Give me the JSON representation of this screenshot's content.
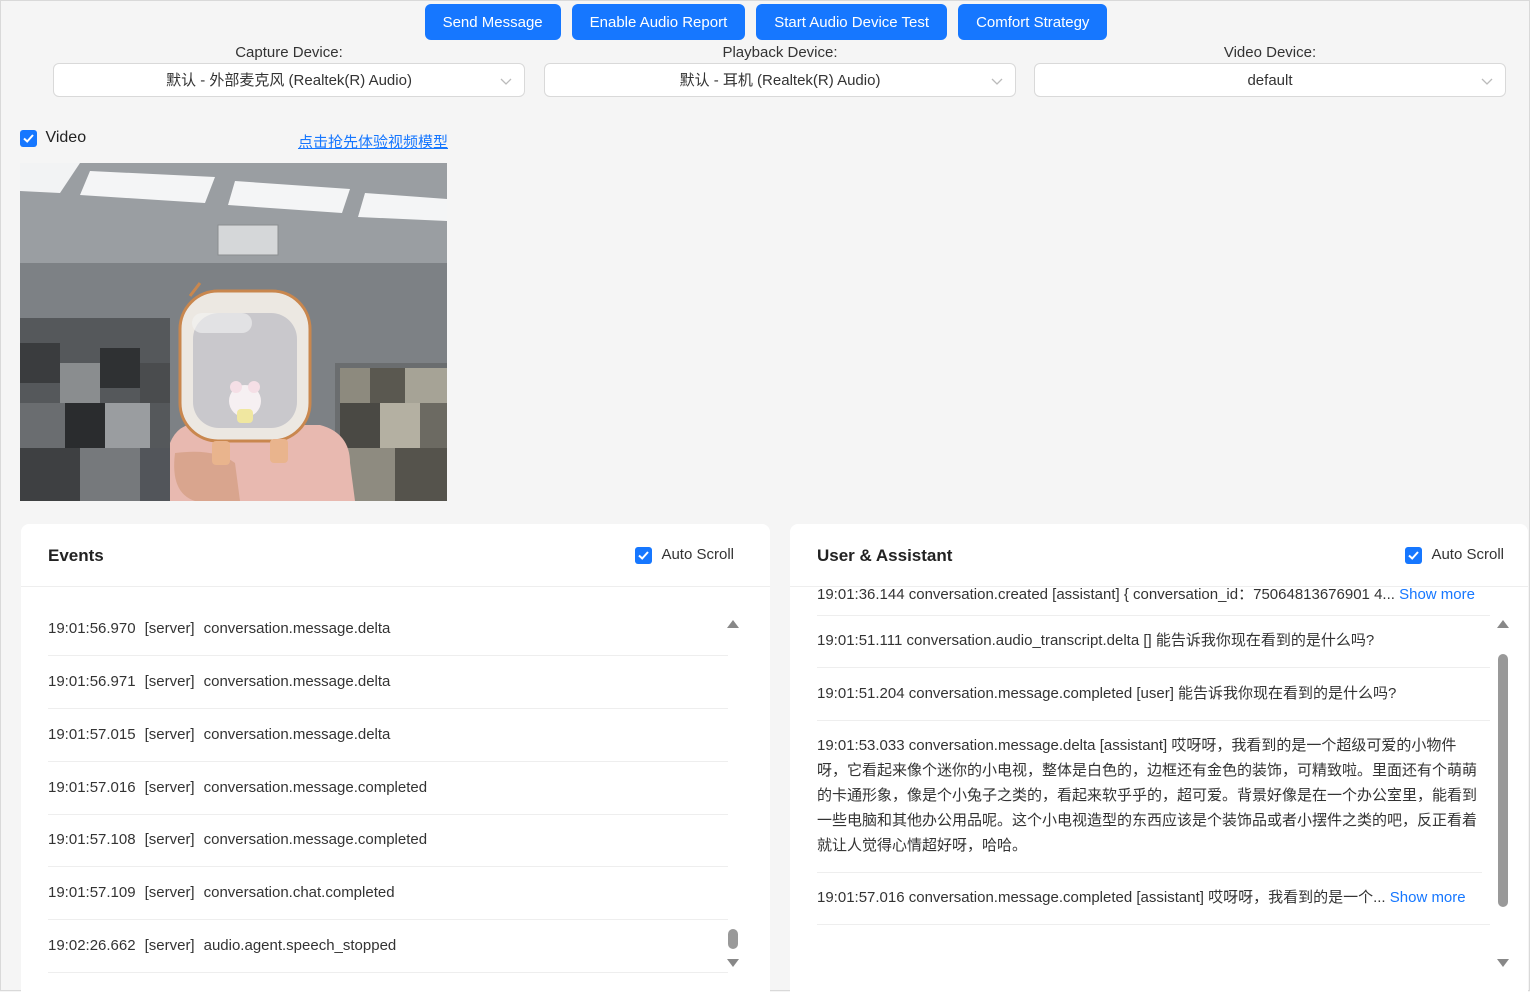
{
  "toolbar": {
    "send_message": "Send Message",
    "enable_audio_report": "Enable Audio Report",
    "start_audio_test": "Start Audio Device Test",
    "comfort_strategy": "Comfort Strategy"
  },
  "devices": {
    "capture": {
      "label": "Capture Device:",
      "value": "默认 - 外部麦克风 (Realtek(R) Audio)"
    },
    "playback": {
      "label": "Playback Device:",
      "value": "默认 - 耳机 (Realtek(R) Audio)"
    },
    "video": {
      "label": "Video Device:",
      "value": "default"
    }
  },
  "video": {
    "checkbox_label": "Video",
    "model_link": "点击抢先体验视频模型"
  },
  "events_panel": {
    "title": "Events",
    "auto_scroll": "Auto Scroll",
    "rows": [
      {
        "time": "19:01:56.970",
        "source": "[server]",
        "event": "conversation.message.delta"
      },
      {
        "time": "19:01:56.971",
        "source": "[server]",
        "event": "conversation.message.delta"
      },
      {
        "time": "19:01:57.015",
        "source": "[server]",
        "event": "conversation.message.delta"
      },
      {
        "time": "19:01:57.016",
        "source": "[server]",
        "event": "conversation.message.completed"
      },
      {
        "time": "19:01:57.108",
        "source": "[server]",
        "event": "conversation.message.completed"
      },
      {
        "time": "19:01:57.109",
        "source": "[server]",
        "event": "conversation.chat.completed"
      },
      {
        "time": "19:02:26.662",
        "source": "[server]",
        "event": "audio.agent.speech_stopped"
      }
    ]
  },
  "chat_panel": {
    "title": "User & Assistant",
    "auto_scroll": "Auto Scroll",
    "show_more": "Show more",
    "messages": [
      {
        "text": "19:01:36.144  conversation.created [assistant] { conversation_id：75064813676901 4..."
      },
      {
        "text": "19:01:51.111  conversation.audio_transcript.delta [] 能告诉我你现在看到的是什么吗?"
      },
      {
        "text": "19:01:51.204  conversation.message.completed [user] 能告诉我你现在看到的是什么吗?"
      },
      {
        "text": "19:01:53.033  conversation.message.delta [assistant] 哎呀呀，我看到的是一个超级可爱的小物件呀，它看起来像个迷你的小电视，整体是白色的，边框还有金色的装饰，可精致啦。里面还有个萌萌的卡通形象，像是个小兔子之类的，看起来软乎乎的，超可爱。背景好像是在一个办公室里，能看到一些电脑和其他办公用品呢。这个小电视造型的东西应该是个装饰品或者小摆件之类的吧，反正看着就让人觉得心情超好呀，哈哈。"
      },
      {
        "text": "19:01:57.016  conversation.message.completed [assistant] 哎呀呀，我看到的是一个..."
      }
    ]
  }
}
